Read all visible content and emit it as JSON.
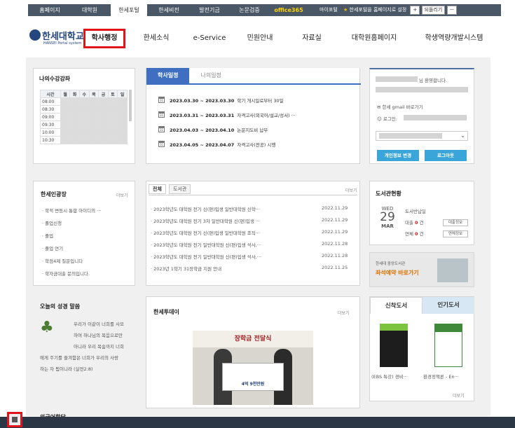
{
  "topbar": {
    "items": [
      "홈페이지",
      "대학원",
      "한세포털",
      "한세비전",
      "발전기금",
      "논문검증",
      "office365"
    ],
    "mypage": "마이포털",
    "homepage_setting": "한세포털을 홈페이지로 설정",
    "plus": "+",
    "back": "되돌리기",
    "minus": "ㅡ"
  },
  "logo": {
    "title": "한세대학교",
    "subtitle": "HANSEI Portal system"
  },
  "mainnav": [
    "학사행정",
    "한세소식",
    "e-Service",
    "민원안내",
    "자료실",
    "대학원홈페이지",
    "학생역량개발시스템"
  ],
  "courses": {
    "title": "나의수강강좌",
    "headers": [
      "시간",
      "월",
      "화",
      "수",
      "목",
      "금",
      "토",
      "일"
    ],
    "times": [
      "08:00",
      "08:30",
      "09:00",
      "09:30",
      "10:00",
      "10:30"
    ]
  },
  "schedule": {
    "tabs": [
      "학사일정",
      "나의일정"
    ],
    "items": [
      {
        "date": "2023.03.30 ~ 2023.03.30",
        "text": "학기 개시일로부터 30일"
      },
      {
        "date": "2023.03.31 ~ 2023.03.31",
        "text": "자격고사(외국어/설교/성서) ···"
      },
      {
        "date": "2023.04.03 ~ 2023.04.10",
        "text": "논문지도비 납부"
      },
      {
        "date": "2023.04.05 ~ 2023.04.07",
        "text": "자격고사(전공) 시행"
      }
    ]
  },
  "user": {
    "welcome": "님 환영합니다.",
    "gmail": "한세 gmail 바로가기",
    "login": "로그인:",
    "edit": "개인정보 변경",
    "logout": "로그아웃"
  },
  "plaza": {
    "title": "한세인광장",
    "more": "더보기",
    "items": [
      "· 학적 변동시 통합 아이디의 ···",
      "· 졸업신청",
      "· 졸업",
      "· 졸업 연기",
      "· 학점4제 질문입니다",
      "· 학자금대출 문의입니다."
    ]
  },
  "notice": {
    "tabs": [
      "전체",
      "도서관"
    ],
    "more": "더보기",
    "items": [
      {
        "text": "· 2023학년도 대학원 전기 신(편)입생 일반대학원 신학···",
        "date": "2022.11.29"
      },
      {
        "text": "· 2023학년도 대학원 전기 3차 일반대학원 신(편)입생 ···",
        "date": "2022.11.29"
      },
      {
        "text": "· 2023학년도 대학원 전기 신(편)입생 일반대학원 조직···",
        "date": "2022.11.29"
      },
      {
        "text": "· 2023학년도 대학원 전기 일반대학원 신(편)입생 석사,···",
        "date": "2022.11.28"
      },
      {
        "text": "· 2023학년도 대학원 전기 일반대학원 신(편)입생 석사,···",
        "date": "2022.11.28"
      },
      {
        "text": "· 2023년 1학기 31장학금 지원 안내",
        "date": "2022.11.25"
      }
    ]
  },
  "library": {
    "title": "도서관현황",
    "day": "WED",
    "date": "29",
    "month": "MAR",
    "due_label": "도서반납일",
    "loan_label": "대출",
    "loan_count": "0",
    "overdue_label": "연체",
    "overdue_count": "0",
    "unit": "건",
    "loan_btn": "대출정보",
    "overdue_btn": "연체정보"
  },
  "seat_banner": {
    "line1": "한세대 중앙도서관",
    "line2": "좌석예약 바로가기"
  },
  "bible": {
    "title": "오늘의 성경 말씀",
    "lines": [
      "우리가 이같이 너희를 사모",
      "하여 하나님의 복음으로만",
      "아니라 우리 목숨까지 너희",
      "에게 주기를 즐겨함은 너희가 우리의 사랑",
      "하는 자 됨이니라 (살전2:8)"
    ]
  },
  "today": {
    "title": "한세투데이",
    "more": "더보기",
    "caption": "장학금 전달식",
    "sign": "4억 9천만원"
  },
  "books": {
    "tabs": [
      "신착도서",
      "인기도서"
    ],
    "items": [
      "(EBS 특강) 경비···",
      "환경정책론 - En···"
    ],
    "more": "더보기"
  },
  "partial_title": "외국어학당"
}
